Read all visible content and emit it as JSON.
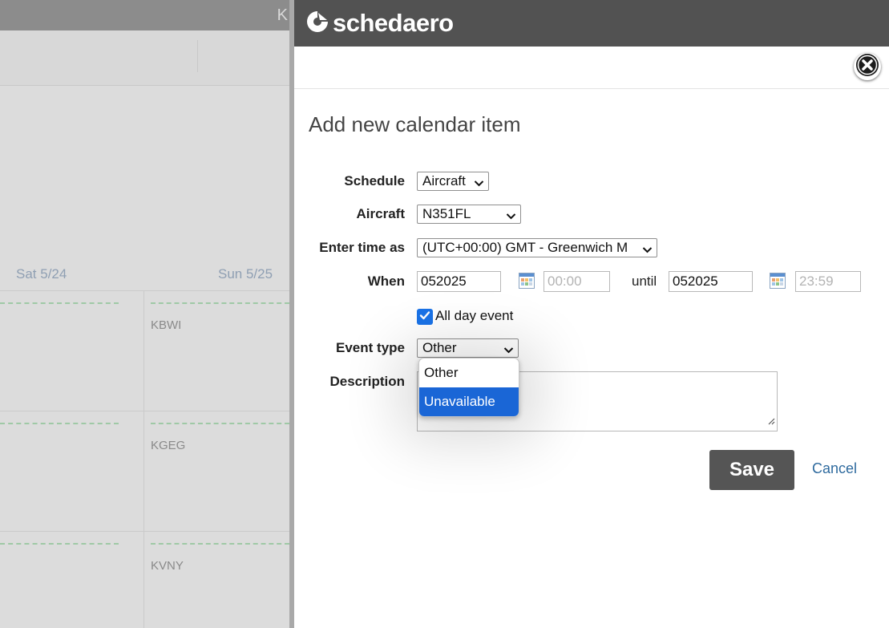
{
  "background": {
    "topbar_letter": "K",
    "days": [
      "Sat 5/24",
      "Sun 5/25"
    ],
    "airports": [
      "KBWI",
      "KGEG",
      "KVNY"
    ]
  },
  "header": {
    "logo_text": "schedaero",
    "logo_icon": "schedaero-logo-icon"
  },
  "form": {
    "title": "Add new calendar item",
    "schedule": {
      "label": "Schedule",
      "value": "Aircraft"
    },
    "aircraft": {
      "label": "Aircraft",
      "value": "N351FL"
    },
    "timezone": {
      "label": "Enter time as",
      "value": "(UTC+00:00) GMT - Greenwich M"
    },
    "when": {
      "label": "When",
      "start_date": "052025",
      "start_time_placeholder": "00:00",
      "until_label": "until",
      "end_date": "052025",
      "end_time_placeholder": "23:59"
    },
    "all_day": {
      "label": "All day event",
      "checked": true
    },
    "event_type": {
      "label": "Event type",
      "value": "Other",
      "options": [
        "Other",
        "Unavailable"
      ],
      "highlighted": "Unavailable"
    },
    "description": {
      "label": "Description",
      "value": ""
    },
    "save_label": "Save",
    "cancel_label": "Cancel"
  },
  "colors": {
    "header": "#525252",
    "accent": "#1a66d6",
    "save_button": "#555555",
    "link": "#2e6a9e"
  }
}
